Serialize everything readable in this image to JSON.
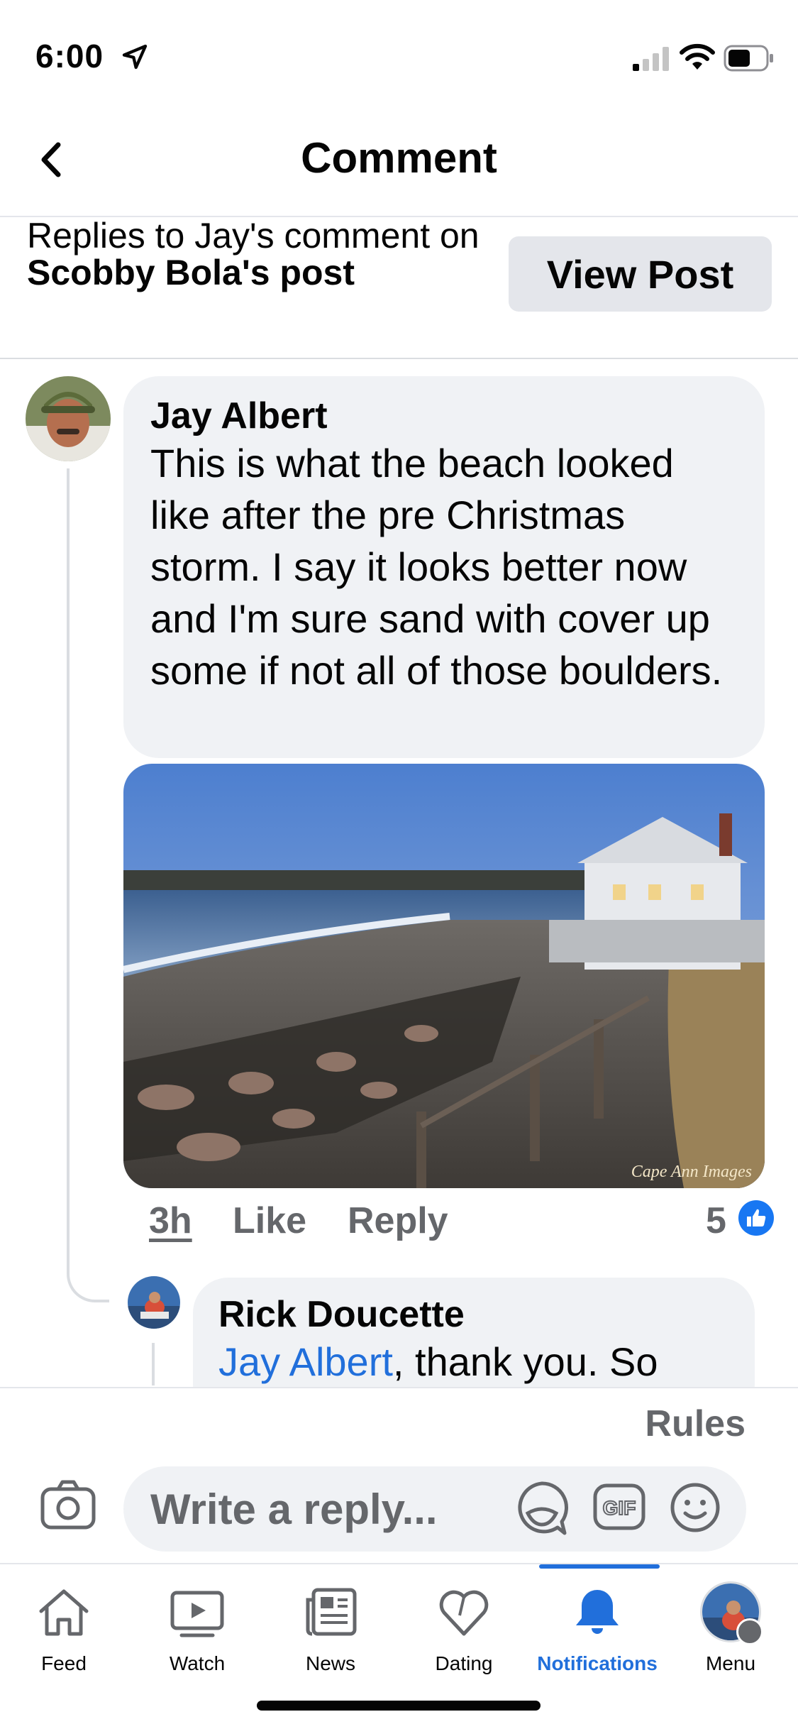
{
  "status_bar": {
    "time": "6:00"
  },
  "header": {
    "title": "Comment"
  },
  "context": {
    "prefix": "Replies to Jay's comment on ",
    "post_owner": "Scobby Bola",
    "suffix": "'s post",
    "view_post_label": "View Post"
  },
  "comment": {
    "author": "Jay Albert",
    "text": "This is what the beach looked like after the pre Christmas storm. I say it looks better now and I'm sure sand with cover up some if not all of those boulders.",
    "photo_watermark": "Cape Ann Images",
    "time": "3h",
    "like_label": "Like",
    "reply_label": "Reply",
    "reaction_count": "5"
  },
  "reply": {
    "author": "Rick Doucette",
    "mention": "Jay Albert",
    "text": ", thank you.  So"
  },
  "composer": {
    "rules_label": "Rules",
    "placeholder": "Write a reply..."
  },
  "tabs": [
    {
      "label": "Feed",
      "icon": "home-icon"
    },
    {
      "label": "Watch",
      "icon": "watch-icon"
    },
    {
      "label": "News",
      "icon": "news-icon"
    },
    {
      "label": "Dating",
      "icon": "heart-icon"
    },
    {
      "label": "Notifications",
      "icon": "bell-icon",
      "active": true
    },
    {
      "label": "Menu",
      "icon": "avatar"
    }
  ],
  "colors": {
    "accent": "#216fdb",
    "secondary_text": "#65676b",
    "bubble": "#f0f2f5"
  }
}
